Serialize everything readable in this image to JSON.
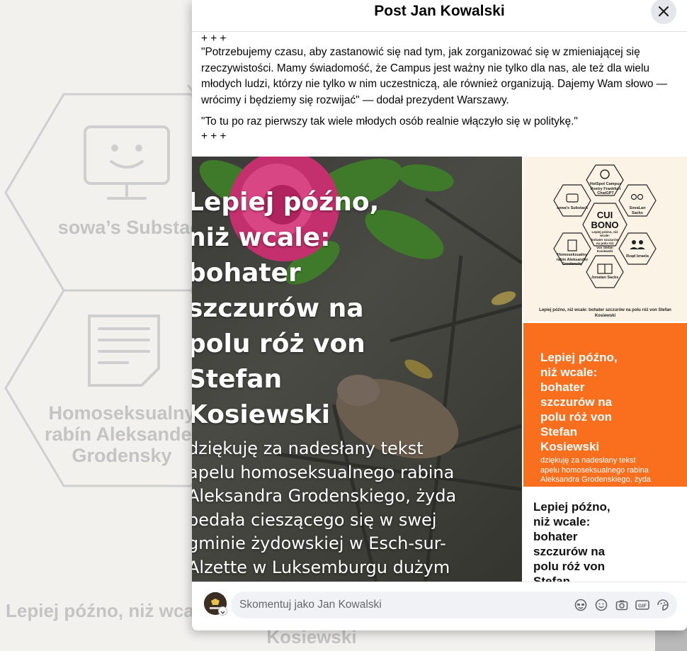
{
  "background": {
    "tiles": [
      {
        "label": "sowa’s Substack",
        "icon": "monitor-smiley-icon"
      },
      {
        "label_lines": [
          "Homoseksualny",
          "rabín Aleksander",
          "Grodensky"
        ],
        "icon": "document-icon"
      }
    ],
    "caption": "Lepiej późno, niż wcale",
    "caption2": "Kosiewski"
  },
  "modal": {
    "title": "Post Jan Kowalski",
    "close_icon": "close-icon"
  },
  "post": {
    "marker_top": "+ + +",
    "paragraph1": "\"Potrzebujemy czasu, aby zastanowić się nad tym, jak zorganizować się w zmieniającej się rzeczywistości. Mamy świadomość, że Campus jest ważny nie tylko dla nas, ale też dla wielu młodych ludzi, którzy nie tylko w nim uczestniczą, ale również organizują. Dajemy Wam słowo — wrócimy i będziemy się rozwijać\" — dodał prezydent Warszawy.",
    "paragraph2": " \"To tu po raz pierwszy tak wiele młodych osób realnie włączyło się w politykę.\"",
    "marker_bottom": "+ + +"
  },
  "photo_main": {
    "title_lines": [
      "Lepiej późno,",
      "niż wcale:",
      "bohater",
      "szczurów na",
      "polu róż von",
      "Stefan",
      "Kosiewski"
    ],
    "body_lines": [
      "dziękuję za nadesłany tekst",
      "apelu homoseksualnego rabina",
      "Aleksandra Grodenskiego, żyda",
      "pedała cieszącego się w swej",
      "gminie żydowskiej w Esch-sur-",
      "Alzette w Luksemburgu dużym"
    ]
  },
  "thumb1": {
    "center_title": "CUI BONO",
    "center_sub": [
      "Lepiej późno, niż wcale:",
      "bohater szczurów",
      "na polu róż",
      "von Stefan",
      "Kosiewski"
    ],
    "cells": [
      {
        "label": "HotSpot Campus Poetry Frankfurt ChatGPT",
        "icon": "openai-icon"
      },
      {
        "label": "sowa's Substack",
        "icon": "monitor-smiley-icon"
      },
      {
        "label": "SovaLan Sacks",
        "icon": "owl-icon"
      },
      {
        "label": "Homoseksualny rabin Aleksander Grodensky",
        "icon": "document-icon"
      },
      {
        "label": "Rząd Izraela",
        "icon": "people-icon"
      },
      {
        "label": "Jonatan Sacks",
        "icon": "book-icon"
      }
    ],
    "caption": "Lepiej późno, niż wcale: bohater szczurów na polu róż von Stefan Kosiewski"
  },
  "thumb2": {
    "title_lines": [
      "Lepiej późno,",
      "niż wcale:",
      "bohater",
      "szczurów na",
      "polu róż von",
      "Stefan",
      "Kosiewski"
    ],
    "body_lines": [
      "dziękuję za nadesłany tekst",
      "apelu homoseksualnego rabina",
      "Aleksandra Grodenskiego, żyda"
    ]
  },
  "thumb3": {
    "title_lines": [
      "Lepiej późno,",
      "niż wcale:",
      "bohater",
      "szczurów na",
      "polu róż von",
      "Stefan"
    ]
  },
  "comment": {
    "placeholder": "Skomentuj jako Jan Kowalski",
    "icons": [
      "avatar-sticker-icon",
      "emoji-icon",
      "camera-icon",
      "gif-icon",
      "sticker-icon"
    ]
  },
  "colors": {
    "orange": "#f96f1e",
    "thumb_bg": "#fbf3e6",
    "input_bg": "#f0f2f5"
  }
}
